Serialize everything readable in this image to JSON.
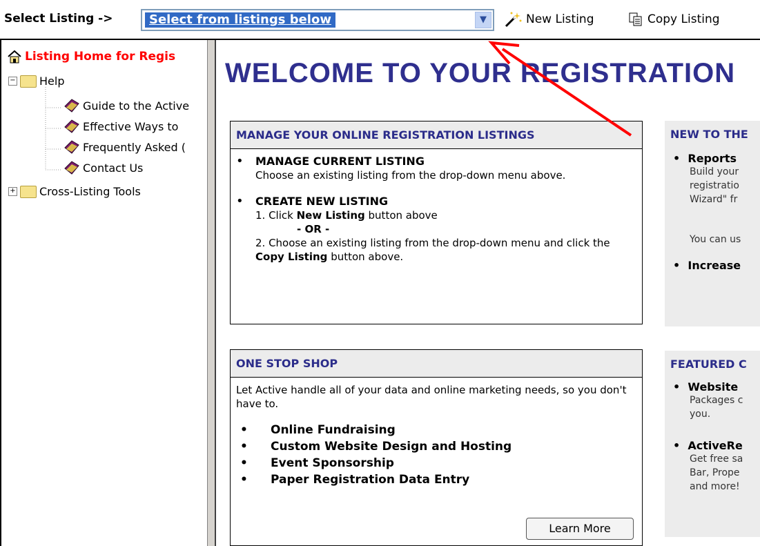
{
  "toolbar": {
    "select_label": "Select Listing ->",
    "select_value": "Select from listings below",
    "new_listing": "New Listing",
    "copy_listing": "Copy Listing"
  },
  "tree": {
    "root": "Listing Home for Regis",
    "help": "Help",
    "items": [
      "Guide to the Active",
      "Effective Ways to",
      "Frequently Asked (",
      "Contact Us"
    ],
    "cross": "Cross-Listing Tools"
  },
  "main": {
    "title": "WELCOME TO YOUR REGISTRATION"
  },
  "manage": {
    "heading": "MANAGE YOUR ONLINE REGISTRATION LISTINGS",
    "current_title": "MANAGE CURRENT LISTING",
    "current_text": "Choose an existing listing from the drop-down menu above.",
    "create_title": "CREATE NEW LISTING",
    "step1_prefix": "1. Click ",
    "step1_bold": "New Listing",
    "step1_suffix": " button above",
    "or": "- OR -",
    "step2_prefix": "2. Choose an existing listing from the drop-down menu and click the ",
    "step2_bold": "Copy Listing",
    "step2_suffix": " button above."
  },
  "onestop": {
    "heading": "ONE STOP SHOP",
    "text": "Let Active handle all of your data and online marketing needs, so you don't have to.",
    "items": [
      "Online Fundraising",
      "Custom Website Design and Hosting",
      "Event Sponsorship",
      "Paper Registration Data Entry"
    ],
    "button": "Learn More"
  },
  "newto": {
    "heading": "NEW TO THE",
    "reports_title": "Reports",
    "reports_lines": [
      "Build your",
      "registratio",
      "Wizard\" fr"
    ],
    "use_line": "You can us",
    "increase": "Increase"
  },
  "featured": {
    "heading": "FEATURED C",
    "website_title": "Website",
    "website_lines": [
      "Packages c",
      "you."
    ],
    "active_title": "ActiveRe",
    "active_lines": [
      "Get free sa",
      "Bar, Prope",
      "and more!"
    ]
  },
  "colors": {
    "title_blue": "#2f2f8e",
    "select_highlight": "#316ac5",
    "tree_root_red": "#ff0000",
    "arrow_red": "#ff0000"
  }
}
